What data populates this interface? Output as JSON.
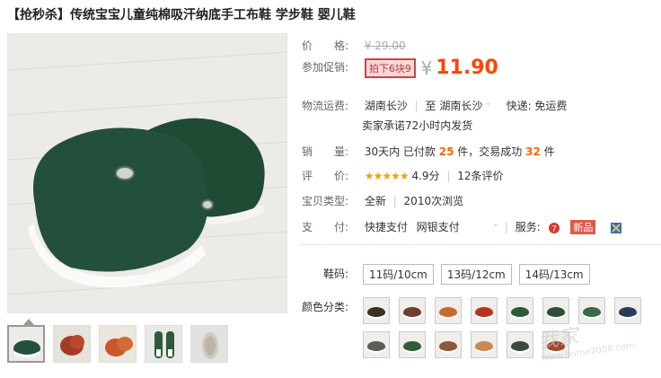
{
  "title": "【抢秒杀】传统宝宝儿童纯棉吸汗纳底手工布鞋 学步鞋 婴儿鞋",
  "price": {
    "label": "价　　格:",
    "original": "¥ 29.00",
    "promo_label": "参加促销:",
    "promo_badge": "拍下6块9",
    "yen": "¥",
    "current": "11.90"
  },
  "shipping": {
    "label": "物流运费:",
    "from": "湖南长沙",
    "to_prefix": "至",
    "to": "湖南长沙",
    "fee": "快递: 免运费",
    "promise": "卖家承诺72小时内发货"
  },
  "sales": {
    "label": "销　　量:",
    "prefix": "30天内 已付款",
    "paid_count": "25",
    "paid_unit": "件，交易成功",
    "success_count": "32",
    "success_unit": "件"
  },
  "rating": {
    "label": "评　　价:",
    "stars": "★★★★★",
    "score": "4.9分",
    "reviews": "12条评价"
  },
  "type": {
    "label": "宝贝类型:",
    "value": "全新",
    "views": "2010次浏览"
  },
  "payment": {
    "label": "支　　付:",
    "method1": "快捷支付",
    "method2": "网银支付",
    "service_label": "服务:",
    "new_badge": "新品"
  },
  "sizes": {
    "label": "鞋码:",
    "options": [
      "11码/10cm",
      "13码/12cm",
      "14码/13cm"
    ]
  },
  "colors": {
    "label": "颜色分类:",
    "swatches": [
      "#3a3124",
      "#6b4030",
      "#c66a2a",
      "#b3361f",
      "#2f5a3a",
      "#2e4f38",
      "#356b45",
      "#2a3c55",
      "#5c5b5a",
      "#315c3a",
      "#8a5a3a",
      "#c78a55",
      "#3c4a3e",
      "#a04a2a"
    ]
  },
  "watermark": {
    "brand": "我家",
    "url": "www.home2008.com"
  },
  "colors_theme": {
    "price": "#ff4400",
    "highlight": "#ff6600",
    "badge_border": "#cc4444"
  }
}
